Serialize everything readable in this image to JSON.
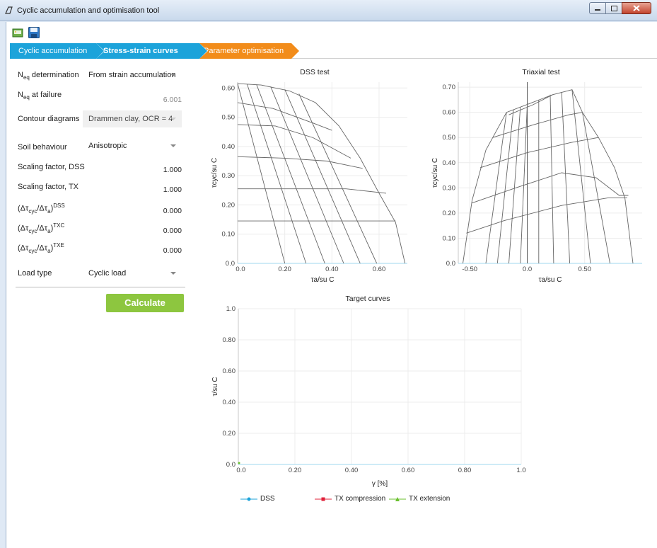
{
  "window": {
    "title": "Cyclic accumulation and optimisation tool"
  },
  "toolbar": {
    "open_icon": "open-file-icon",
    "save_icon": "save-icon"
  },
  "steps": [
    {
      "label": "Cyclic accumulation"
    },
    {
      "label": "Stress-strain curves"
    },
    {
      "label": "Parameter optimisation"
    }
  ],
  "panel": {
    "neq_det_label_main": "N",
    "neq_det_label_sub": "eq",
    "neq_det_label_rest": " determination",
    "neq_det_value": "From strain accumulation",
    "neq_fail_label_main": "N",
    "neq_fail_label_sub": "eq",
    "neq_fail_label_rest": " at failure",
    "neq_fail_value": "6.001",
    "contour_label": "Contour diagrams",
    "contour_value": "Drammen clay, OCR = 4",
    "soil_label": "Soil behaviour",
    "soil_value": "Anisotropic",
    "scale_dss_label": "Scaling factor, DSS",
    "scale_dss_value": "1.000",
    "scale_tx_label": "Scaling factor, TX",
    "scale_tx_value": "1.000",
    "ratio_dss_sup": "DSS",
    "ratio_dss_value": "0.000",
    "ratio_txc_sup": "TXC",
    "ratio_txc_value": "0.000",
    "ratio_txe_sup": "TXE",
    "ratio_txe_value": "0.000",
    "load_label": "Load type",
    "load_value": "Cyclic load",
    "calculate": "Calculate"
  },
  "charts": {
    "dss_title": "DSS test",
    "tx_title": "Triaxial test",
    "target_title": "Target curves",
    "target_xlabel": "γ [%]",
    "legend_dss": "DSS",
    "legend_txc": "TX compression",
    "legend_txe": "TX extension"
  },
  "chart_data": [
    {
      "type": "line",
      "title": "DSS test",
      "xlabel": "τa/su C",
      "ylabel": "τcyc/su C",
      "xlim": [
        0,
        0.72
      ],
      "ylim": [
        0,
        0.62
      ],
      "xticks": [
        "0.0",
        "0.20",
        "0.40",
        "0.60"
      ],
      "yticks": [
        "0.0",
        "0.10",
        "0.20",
        "0.30",
        "0.40",
        "0.50",
        "0.60"
      ],
      "contours_radial": [
        [
          [
            0,
            0.615
          ],
          [
            0.2,
            0
          ]
        ],
        [
          [
            0.04,
            0.614
          ],
          [
            0.29,
            0
          ]
        ],
        [
          [
            0.08,
            0.612
          ],
          [
            0.37,
            0
          ]
        ],
        [
          [
            0.14,
            0.605
          ],
          [
            0.45,
            0
          ]
        ],
        [
          [
            0.2,
            0.595
          ],
          [
            0.52,
            0
          ]
        ],
        [
          [
            0.26,
            0.58
          ],
          [
            0.59,
            0
          ]
        ]
      ],
      "contours_level": [
        [
          [
            0,
            0.615
          ],
          [
            0.1,
            0.61
          ],
          [
            0.22,
            0.59
          ],
          [
            0.33,
            0.55
          ],
          [
            0.43,
            0.47
          ],
          [
            0.52,
            0.36
          ],
          [
            0.6,
            0.24
          ],
          [
            0.67,
            0.14
          ],
          [
            0.71,
            0
          ]
        ],
        [
          [
            0,
            0.55
          ],
          [
            0.15,
            0.53
          ],
          [
            0.32,
            0.48
          ],
          [
            0.4,
            0.455
          ]
        ],
        [
          [
            0,
            0.475
          ],
          [
            0.16,
            0.47
          ],
          [
            0.32,
            0.43
          ],
          [
            0.48,
            0.36
          ]
        ],
        [
          [
            0,
            0.365
          ],
          [
            0.2,
            0.36
          ],
          [
            0.38,
            0.35
          ],
          [
            0.53,
            0.325
          ]
        ],
        [
          [
            0,
            0.255
          ],
          [
            0.25,
            0.255
          ],
          [
            0.46,
            0.255
          ],
          [
            0.63,
            0.24
          ]
        ],
        [
          [
            0,
            0.145
          ],
          [
            0.3,
            0.145
          ],
          [
            0.55,
            0.145
          ],
          [
            0.67,
            0.145
          ]
        ]
      ]
    },
    {
      "type": "line",
      "title": "Triaxial test",
      "xlabel": "τa/su C",
      "ylabel": "τcyc/su C",
      "xlim": [
        -0.6,
        1.0
      ],
      "ylim": [
        0,
        0.72
      ],
      "xticks": [
        "-0.50",
        "0.0",
        "0.50"
      ],
      "yticks": [
        "0.0",
        "0.10",
        "0.20",
        "0.30",
        "0.40",
        "0.50",
        "0.60",
        "0.70"
      ],
      "grid": true
    },
    {
      "type": "line",
      "title": "Target curves",
      "xlabel": "γ [%]",
      "ylabel": "τ/su C",
      "xlim": [
        0,
        1.0
      ],
      "ylim": [
        0,
        1.0
      ],
      "xticks": [
        "0.0",
        "0.20",
        "0.40",
        "0.60",
        "0.80",
        "1.0"
      ],
      "yticks": [
        "0.0",
        "0.20",
        "0.40",
        "0.60",
        "0.80",
        "1.0"
      ],
      "series": [
        {
          "name": "DSS",
          "color": "#1ca3da",
          "values": []
        },
        {
          "name": "TX compression",
          "color": "#e0203a",
          "values": []
        },
        {
          "name": "TX extension",
          "color": "#6abf2e",
          "values": []
        }
      ],
      "legend": "bottom"
    }
  ]
}
